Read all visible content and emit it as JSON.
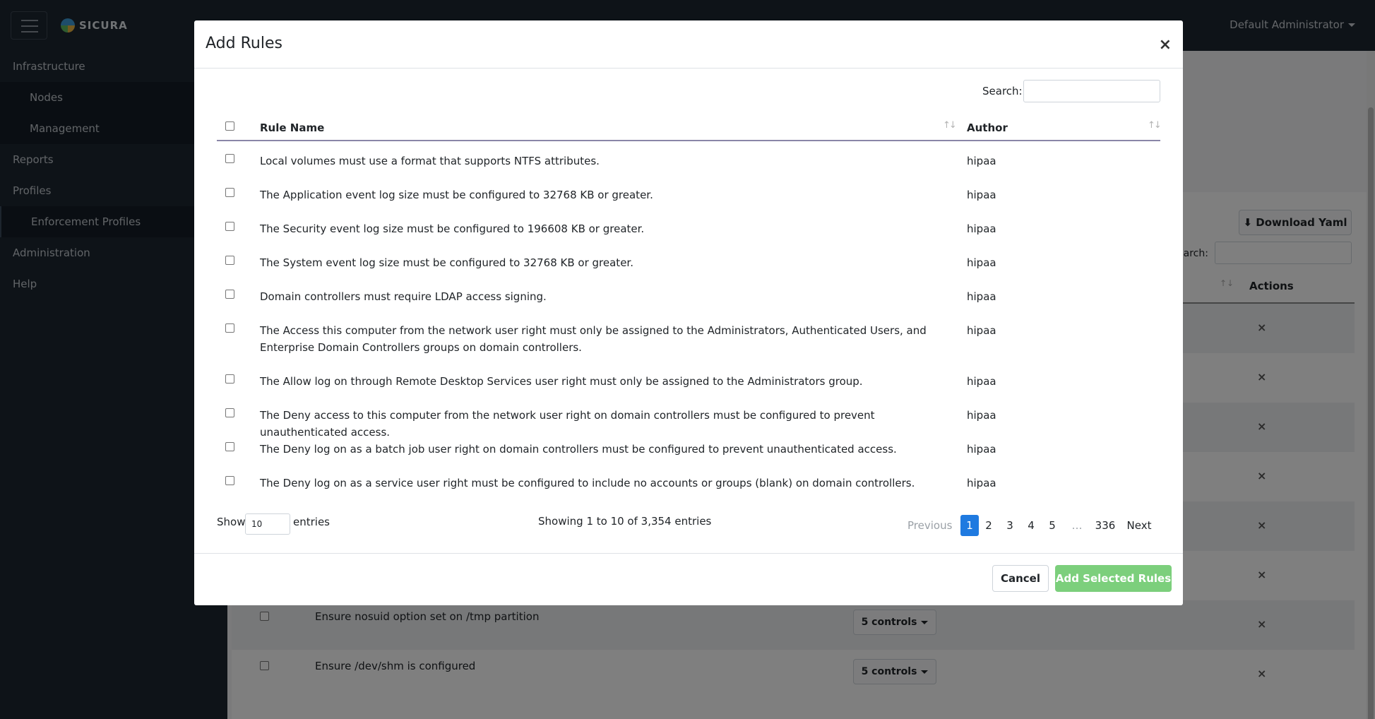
{
  "app": {
    "logo_text": "SICURA",
    "user_name": "Default Administrator"
  },
  "sidebar": {
    "items": [
      {
        "label": "Infrastructure"
      },
      {
        "label": "Nodes"
      },
      {
        "label": "Management"
      },
      {
        "label": "Reports"
      },
      {
        "label": "Profiles"
      },
      {
        "label": "Enforcement Profiles"
      },
      {
        "label": "Administration"
      },
      {
        "label": "Help"
      }
    ]
  },
  "background": {
    "download_label": "Download Yaml",
    "search_label": "earch:",
    "actions_header": "Actions",
    "rows": [
      {
        "rule": "Ensure nosuid option set on /tmp partition",
        "controls": "5 controls"
      },
      {
        "rule": "Ensure /dev/shm is configured",
        "controls": "5 controls"
      }
    ],
    "remove_icon": "×"
  },
  "modal": {
    "title": "Add Rules",
    "close": "×",
    "search_label": "Search:",
    "headers": {
      "rule_name": "Rule Name",
      "author": "Author"
    },
    "rows": [
      {
        "rule": "Local volumes must use a format that supports NTFS attributes.",
        "author": "hipaa"
      },
      {
        "rule": "The Application event log size must be configured to 32768 KB or greater.",
        "author": "hipaa"
      },
      {
        "rule": "The Security event log size must be configured to 196608 KB or greater.",
        "author": "hipaa"
      },
      {
        "rule": "The System event log size must be configured to 32768 KB or greater.",
        "author": "hipaa"
      },
      {
        "rule": "Domain controllers must require LDAP access signing.",
        "author": "hipaa"
      },
      {
        "rule": "The Access this computer from the network user right must only be assigned to the Administrators, Authenticated Users, and Enterprise Domain Controllers groups on domain controllers.",
        "author": "hipaa"
      },
      {
        "rule": "The Allow log on through Remote Desktop Services user right must only be assigned to the Administrators group.",
        "author": "hipaa"
      },
      {
        "rule": "The Deny access to this computer from the network user right on domain controllers must be configured to prevent unauthenticated access.",
        "author": "hipaa"
      },
      {
        "rule": "The Deny log on as a batch job user right on domain controllers must be configured to prevent unauthenticated access.",
        "author": "hipaa"
      },
      {
        "rule": "The Deny log on as a service user right must be configured to include no accounts or groups (blank) on domain controllers.",
        "author": "hipaa"
      }
    ],
    "show_label": "Show",
    "show_value": "10",
    "entries_label": "entries",
    "info": "Showing 1 to 10 of 3,354 entries",
    "pagination": {
      "previous": "Previous",
      "pages": [
        "1",
        "2",
        "3",
        "4",
        "5"
      ],
      "ellipsis": "…",
      "last": "336",
      "next": "Next"
    },
    "cancel_label": "Cancel",
    "add_label": "Add Selected Rules"
  }
}
